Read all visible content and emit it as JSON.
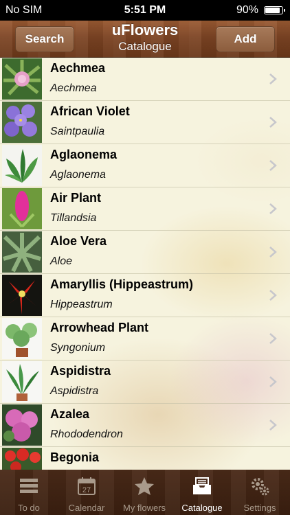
{
  "status": {
    "carrier": "No SIM",
    "time": "5:51 PM",
    "battery": "90%",
    "battery_level": 0.9
  },
  "nav": {
    "title": "uFlowers",
    "subtitle": "Catalogue",
    "left_button": "Search",
    "right_button": "Add"
  },
  "plants": [
    {
      "name": "Aechmea",
      "latin": "Aechmea"
    },
    {
      "name": "African Violet",
      "latin": "Saintpaulia"
    },
    {
      "name": "Aglaonema",
      "latin": "Aglaonema"
    },
    {
      "name": "Air Plant",
      "latin": "Tillandsia"
    },
    {
      "name": "Aloe Vera",
      "latin": "Aloe"
    },
    {
      "name": "Amaryllis (Hippeastrum)",
      "latin": "Hippeastrum"
    },
    {
      "name": "Arrowhead Plant",
      "latin": "Syngonium"
    },
    {
      "name": "Aspidistra",
      "latin": "Aspidistra"
    },
    {
      "name": "Azalea",
      "latin": "Rhododendron"
    },
    {
      "name": "Begonia",
      "latin": ""
    }
  ],
  "tabs": [
    {
      "label": "To do",
      "icon": "list-icon"
    },
    {
      "label": "Calendar",
      "icon": "calendar-icon",
      "day": "27"
    },
    {
      "label": "My flowers",
      "icon": "star-icon"
    },
    {
      "label": "Catalogue",
      "icon": "catalogue-tray-icon",
      "active": true
    },
    {
      "label": "Settings",
      "icon": "gears-icon"
    }
  ]
}
